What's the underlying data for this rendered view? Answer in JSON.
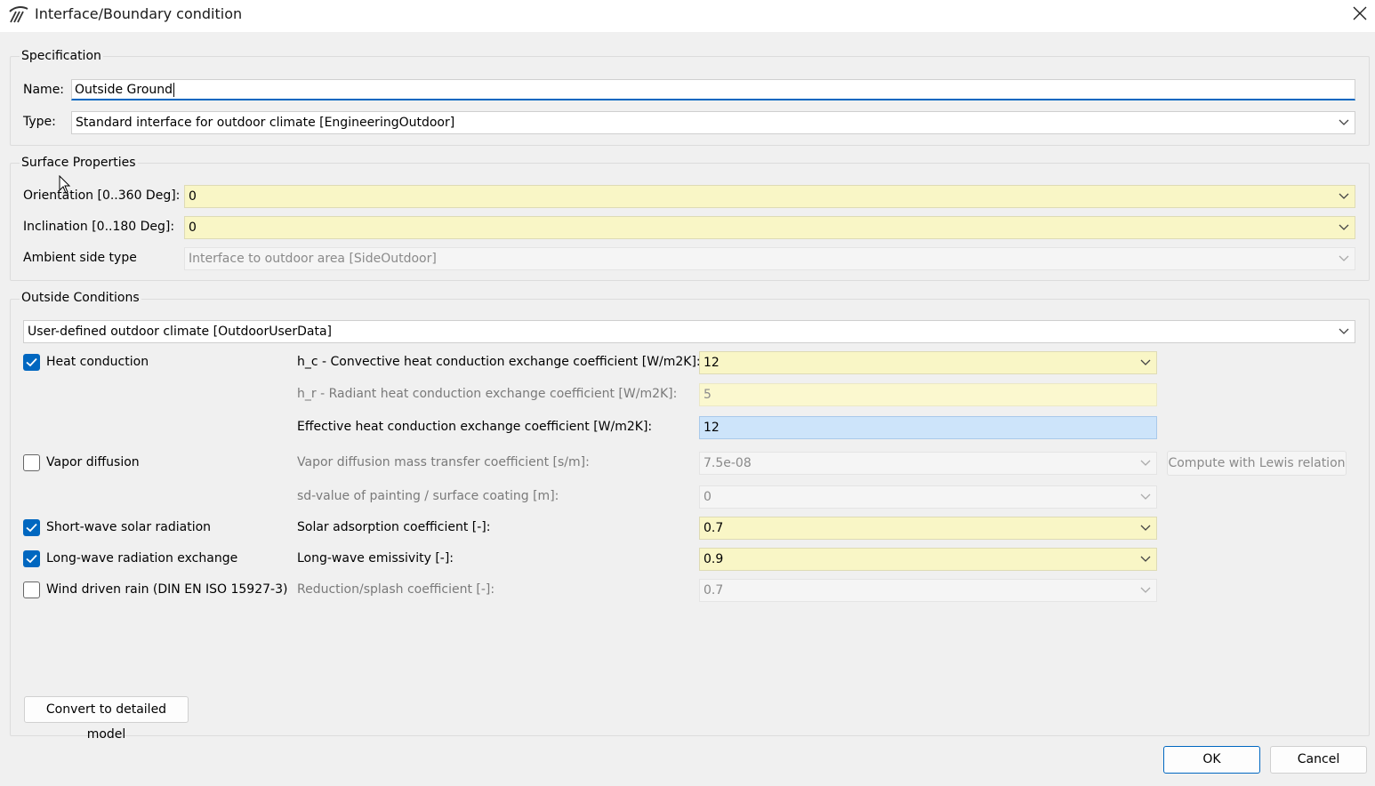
{
  "window": {
    "title": "Interface/Boundary condition"
  },
  "specification": {
    "title": "Specification",
    "name_label": "Name:",
    "name_value": "Outside Ground",
    "type_label": "Type:",
    "type_value": "Standard interface for outdoor climate [EngineeringOutdoor]"
  },
  "surface": {
    "title": "Surface Properties",
    "orientation_label": "Orientation [0..360 Deg]:",
    "orientation_value": "0",
    "inclination_label": "Inclination [0..180 Deg]:",
    "inclination_value": "0",
    "ambient_label": "Ambient side type",
    "ambient_value": "Interface to outdoor area [SideOutdoor]"
  },
  "outside": {
    "title": "Outside Conditions",
    "climate_value": "User-defined outdoor climate [OutdoorUserData]",
    "heat_conduction": {
      "label": "Heat conduction",
      "checked": true,
      "hc_label": "h_c - Convective heat conduction exchange coefficient [W/m2K]:",
      "hc_value": "12",
      "hr_label": "h_r - Radiant heat conduction exchange coefficient [W/m2K]:",
      "hr_value": "5",
      "eff_label": "Effective heat conduction exchange coefficient [W/m2K]:",
      "eff_value": "12"
    },
    "vapor": {
      "label": "Vapor diffusion",
      "checked": false,
      "coef_label": "Vapor diffusion mass transfer coefficient [s/m]:",
      "coef_value": "7.5e-08",
      "lewis_button": "Compute with Lewis relation",
      "sd_label": "sd-value of painting / surface coating [m]:",
      "sd_value": "0"
    },
    "shortwave": {
      "label": "Short-wave solar radiation",
      "checked": true,
      "coef_label": "Solar adsorption coefficient [-]:",
      "coef_value": "0.7"
    },
    "longwave": {
      "label": "Long-wave radiation exchange",
      "checked": true,
      "coef_label": "Long-wave emissivity [-]:",
      "coef_value": "0.9"
    },
    "rain": {
      "label": "Wind driven rain (DIN EN ISO 15927-3)",
      "checked": false,
      "coef_label": "Reduction/splash coefficient [-]:",
      "coef_value": "0.7"
    },
    "convert_button": "Convert to detailed model"
  },
  "buttons": {
    "ok": "OK",
    "cancel": "Cancel"
  },
  "colors": {
    "accent": "#0067c0",
    "highlight_yellow": "#f9f6c6",
    "highlight_blue": "#cde4fa"
  }
}
